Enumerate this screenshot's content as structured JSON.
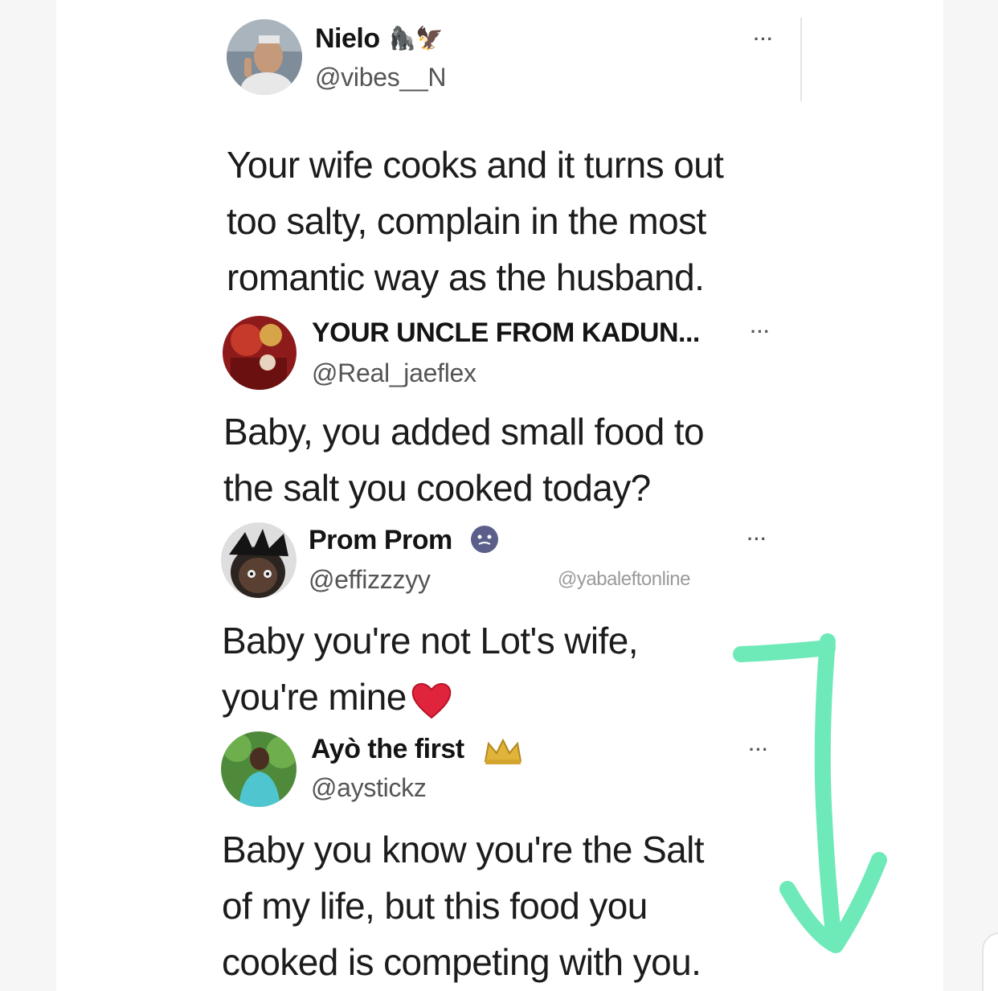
{
  "tweets": [
    {
      "name": "Nielo",
      "name_emoji": "🦍🦅",
      "handle": "@vibes__N",
      "more": "···",
      "lines": [
        "Your wife cooks and it turns out",
        "too salty, complain in the most",
        "romantic way as the husband."
      ]
    },
    {
      "name": "YOUR UNCLE FROM KADUN...",
      "handle": "@Real_jaeflex",
      "more": "···",
      "lines": [
        "Baby, you added small food to",
        "the salt you cooked today?"
      ]
    },
    {
      "name": "Prom Prom",
      "handle": "@effizzzyy",
      "more": "···",
      "lines": [
        "Baby you're not Lot's wife,",
        "you're mine"
      ],
      "line_emoji": "❤️"
    },
    {
      "name": "Ayò the first",
      "name_emoji": "👑",
      "handle": "@aystickz",
      "more": "···",
      "lines": [
        "Baby you know you're the Salt",
        "of my life, but this food you",
        "cooked is competing with you."
      ]
    }
  ],
  "watermark": "@yabaleftonline",
  "colors": {
    "arrow": "#6ee9b8",
    "heart": "#e0243b",
    "badge": "#5b5f8a",
    "crown": "#e0b43a"
  },
  "icons": {
    "more": "more-horizontal-icon",
    "arrow": "arrow-down-icon",
    "heart": "heart-icon",
    "crown": "crown-icon"
  }
}
